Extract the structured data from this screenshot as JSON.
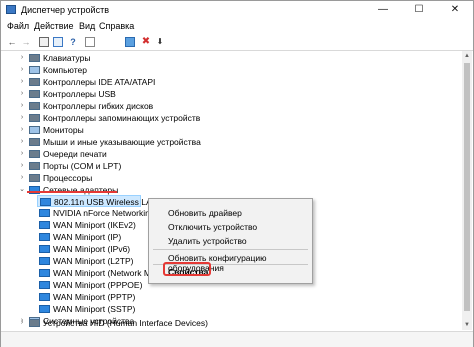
{
  "window": {
    "title": "Диспетчер устройств",
    "controls": {
      "minimize": "—",
      "maximize": "☐",
      "close": "✕"
    }
  },
  "menu": [
    "Файл",
    "Действие",
    "Вид",
    "Справка"
  ],
  "toolbar": {
    "icons": [
      "back-arrow-icon",
      "forward-arrow-icon",
      "properties-box-icon",
      "help-icon",
      "grid-icon",
      "scan-monitor-icon",
      "remove-red-x-icon",
      "download-circle-icon"
    ],
    "glyphs": {
      "back": "←",
      "forward": "→",
      "help": "?",
      "remove": "✖",
      "download": "⬇"
    }
  },
  "tree": {
    "items": [
      {
        "label": "Клавиатуры",
        "expanded": false
      },
      {
        "label": "Компьютер",
        "expanded": false
      },
      {
        "label": "Контроллеры IDE ATA/ATAPI",
        "expanded": false
      },
      {
        "label": "Контроллеры USB",
        "expanded": false
      },
      {
        "label": "Контроллеры гибких дисков",
        "expanded": false
      },
      {
        "label": "Контроллеры запоминающих устройств",
        "expanded": false
      },
      {
        "label": "Мониторы",
        "expanded": false
      },
      {
        "label": "Мыши и иные указывающие устройства",
        "expanded": false
      },
      {
        "label": "Очереди печати",
        "expanded": false
      },
      {
        "label": "Порты (COM и LPT)",
        "expanded": false
      },
      {
        "label": "Процессоры",
        "expanded": false
      },
      {
        "label": "Сетевые адаптеры",
        "expanded": true
      }
    ],
    "network_children": [
      {
        "label": "802.11n USB Wireless LAN Card",
        "selected": true
      },
      {
        "label": "NVIDIA nForce Networking Co"
      },
      {
        "label": "WAN Miniport (IKEv2)"
      },
      {
        "label": "WAN Miniport (IP)"
      },
      {
        "label": "WAN Miniport (IPv6)"
      },
      {
        "label": "WAN Miniport (L2TP)"
      },
      {
        "label": "WAN Miniport (Network Mon"
      },
      {
        "label": "WAN Miniport (PPPOE)"
      },
      {
        "label": "WAN Miniport (PPTP)"
      },
      {
        "label": "WAN Miniport (SSTP)"
      }
    ],
    "after": [
      {
        "label": "Системные устройства",
        "expanded": false
      },
      {
        "label": "Устройства HID (Human Interface Devices)",
        "expanded": false
      }
    ]
  },
  "context_menu": {
    "items": [
      "Обновить драйвер",
      "Отключить устройство",
      "Удалить устройство",
      "Обновить конфигурацию оборудования",
      "Свойства"
    ]
  },
  "accent": {
    "selection": "#cde8ff",
    "highlight": "#e53935"
  }
}
